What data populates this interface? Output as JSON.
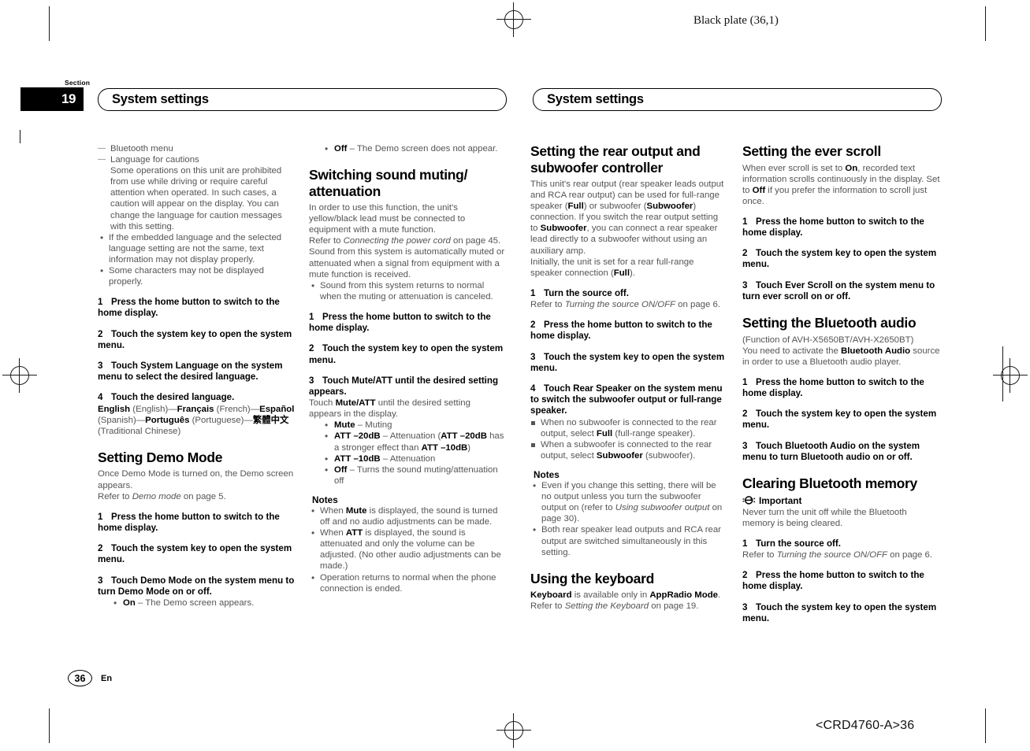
{
  "page": {
    "black_plate": "Black plate (36,1)",
    "crd_code": "<CRD4760-A>36",
    "page_number": "36",
    "language_code": "En",
    "section_label": "Section",
    "section_number": "19",
    "running_head_left": "System settings",
    "running_head_right": "System settings"
  },
  "col1": {
    "dash_items": [
      {
        "text": "Bluetooth menu",
        "cont": ""
      },
      {
        "text": "Language for cautions",
        "cont": "Some operations on this unit are prohibited from use while driving or require careful attention when operated. In such cases, a caution will appear on the display. You can change the language for caution messages with this setting."
      }
    ],
    "bullets": [
      "If the embedded language and the selected language setting are not the same, text information may not display properly.",
      "Some characters may not be displayed properly."
    ],
    "steps": [
      {
        "n": "1",
        "text": "Press the home button to switch to the home display."
      },
      {
        "n": "2",
        "text": "Touch the system key to open the system menu."
      },
      {
        "n": "3",
        "text": "Touch System Language on the system menu to select the desired language."
      },
      {
        "n": "4",
        "text": "Touch the desired language."
      }
    ],
    "language_list_pre": "English",
    "language_list": " (English)—",
    "lang_fr": "Français",
    "lang_fr_after": " (French)—",
    "lang_es": "Español",
    "lang_es_after": " (Spanish)—",
    "lang_pt": "Português",
    "lang_pt_after": " (Portuguese)—",
    "lang_zh": "繁體中文",
    "lang_zh_after": " (Traditional Chinese)",
    "demo_heading": "Setting Demo Mode",
    "demo_intro": "Once Demo Mode is turned on, the Demo screen appears.",
    "demo_refer_pre": "Refer to ",
    "demo_refer_italic": "Demo mode",
    "demo_refer_post": " on page 5.",
    "demo_steps": [
      {
        "n": "1",
        "text": "Press the home button to switch to the home display."
      },
      {
        "n": "2",
        "text": "Touch the system key to open the system menu."
      },
      {
        "n": "3",
        "text": "Touch Demo Mode on the system menu to turn Demo Mode on or off."
      }
    ],
    "demo_on_bold": "On",
    "demo_on_rest": " – The Demo screen appears."
  },
  "col2": {
    "demo_off_bold": "Off",
    "demo_off_rest": " – The Demo screen does not appear.",
    "mute_heading": "Switching sound muting/ attenuation",
    "mute_intro": "In order to use this function, the unit's yellow/black lead must be connected to equipment with a mute function.",
    "mute_refer_pre": "Refer to ",
    "mute_refer_italic": "Connecting the power cord",
    "mute_refer_post": " on page 45.",
    "mute_auto": "Sound from this system is automatically muted or attenuated when a signal from equipment with a mute function is received.",
    "mute_bullet1": "Sound from this system returns to normal when the muting or attenuation is canceled.",
    "steps": [
      {
        "n": "1",
        "text": "Press the home button to switch to the home display."
      },
      {
        "n": "2",
        "text": "Touch the system key to open the system menu."
      },
      {
        "n": "3",
        "text": "Touch Mute/ATT until the desired setting appears."
      }
    ],
    "touch_line_pre": "Touch ",
    "touch_line_bold": "Mute/ATT",
    "touch_line_post": " until the desired setting appears in the display.",
    "options": [
      {
        "bold": "Mute",
        "rest": " – Muting"
      },
      {
        "bold": "ATT –20dB",
        "rest": " – Attenuation (",
        "bold2": "ATT –20dB",
        "rest2": " has a stronger effect than ",
        "bold3": "ATT –10dB",
        "rest3": ")"
      },
      {
        "bold": "ATT –10dB",
        "rest": " – Attenuation"
      },
      {
        "bold": "Off",
        "rest": " – Turns the sound muting/attenuation off"
      }
    ],
    "notes_title": "Notes",
    "notes": [
      {
        "pre": "When ",
        "bold": "Mute",
        "post": " is displayed, the sound is turned off and no audio adjustments can be made."
      },
      {
        "pre": "When ",
        "bold": "ATT",
        "post": " is displayed, the sound is attenuated and only the volume can be adjusted. (No other audio adjustments can be made.)"
      },
      {
        "pre": "Operation returns to normal when the phone connection is ended.",
        "bold": "",
        "post": ""
      }
    ]
  },
  "col3": {
    "rear_heading": "Setting the rear output and subwoofer controller",
    "rear_p1a": "This unit's rear output (rear speaker leads output and RCA rear output) can be used for full-range speaker (",
    "rear_b1": "Full",
    "rear_p1b": ") or subwoofer (",
    "rear_b2": "Subwoofer",
    "rear_p1c": ") connection. If you switch the rear output setting to ",
    "rear_b3": "Subwoofer",
    "rear_p1d": ", you can connect a rear speaker lead directly to a subwoofer without using an auxiliary amp.",
    "rear_p2a": "Initially, the unit is set for a rear full-range speaker connection (",
    "rear_b4": "Full",
    "rear_p2b": ").",
    "step1": {
      "n": "1",
      "text": "Turn the source off."
    },
    "step1_refer_pre": "Refer to ",
    "step1_refer_italic": "Turning the source ON/OFF",
    "step1_refer_post": " on page 6.",
    "steps": [
      {
        "n": "2",
        "text": "Press the home button to switch to the home display."
      },
      {
        "n": "3",
        "text": "Touch the system key to open the system menu."
      },
      {
        "n": "4",
        "text": "Touch Rear Speaker on the system menu to switch the subwoofer output or full-range speaker."
      }
    ],
    "sq_items": [
      {
        "pre": "When no subwoofer is connected to the rear output, select ",
        "bold": "Full",
        "post": " (full-range speaker)."
      },
      {
        "pre": "When a subwoofer is connected to the rear output, select ",
        "bold": "Subwoofer",
        "post": " (subwoofer)."
      }
    ],
    "notes_title": "Notes",
    "notes": [
      {
        "pre": "Even if you change this setting, there will be no output unless you turn the subwoofer output on (refer to ",
        "italic": "Using subwoofer output",
        "post": " on page 30)."
      },
      {
        "pre": "Both rear speaker lead outputs and RCA rear output are switched simultaneously in this setting.",
        "italic": "",
        "post": ""
      }
    ],
    "keyboard_heading": "Using the keyboard",
    "keyboard_b1": "Keyboard",
    "keyboard_p1": " is available only in ",
    "keyboard_b2": "AppRadio Mode",
    "keyboard_p2": ".",
    "keyboard_refer_pre": "Refer to ",
    "keyboard_refer_italic": "Setting the Keyboard",
    "keyboard_refer_post": " on page 19."
  },
  "col4": {
    "ever_heading": "Setting the ever scroll",
    "ever_p_a": "When ever scroll is set to ",
    "ever_b1": "On",
    "ever_p_b": ", recorded text information scrolls continuously in the display. Set to ",
    "ever_b2": "Off",
    "ever_p_c": " if you prefer the information to scroll just once.",
    "ever_steps": [
      {
        "n": "1",
        "text": "Press the home button to switch to the home display."
      },
      {
        "n": "2",
        "text": "Touch the system key to open the system menu."
      },
      {
        "n": "3",
        "text": "Touch Ever Scroll on the system menu to turn ever scroll on or off."
      }
    ],
    "bt_heading": "Setting the Bluetooth audio",
    "bt_function": "(Function of AVH-X5650BT/AVH-X2650BT)",
    "bt_p_a": "You need to activate the ",
    "bt_b1": "Bluetooth Audio",
    "bt_p_b": " source in order to use a Bluetooth audio player.",
    "bt_steps": [
      {
        "n": "1",
        "text": "Press the home button to switch to the home display."
      },
      {
        "n": "2",
        "text": "Touch the system key to open the system menu."
      },
      {
        "n": "3",
        "text": "Touch Bluetooth Audio on the system menu to turn Bluetooth audio on or off."
      }
    ],
    "clear_heading": "Clearing Bluetooth memory",
    "important_label": "Important",
    "clear_warning": "Never turn the unit off while the Bluetooth memory is being cleared.",
    "clear_step1": {
      "n": "1",
      "text": "Turn the source off."
    },
    "clear_refer_pre": "Refer to ",
    "clear_refer_italic": "Turning the source ON/OFF",
    "clear_refer_post": " on page 6.",
    "clear_steps": [
      {
        "n": "2",
        "text": "Press the home button to switch to the home display."
      },
      {
        "n": "3",
        "text": "Touch the system key to open the system menu."
      }
    ]
  }
}
